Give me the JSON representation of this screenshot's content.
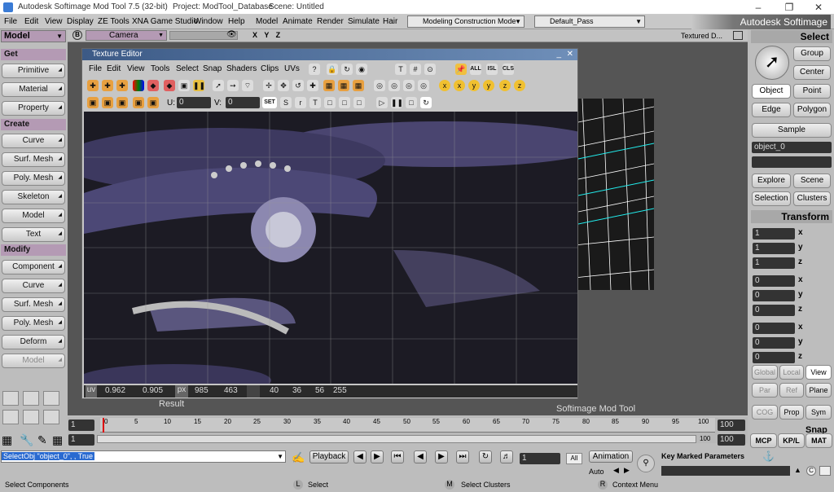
{
  "titlebar": {
    "app": "Autodesk Softimage Mod Tool 7.5 (32-bit)",
    "project": "Project: ModTool_Database",
    "scene": "Scene: Untitled"
  },
  "menu": [
    "File",
    "Edit",
    "View",
    "Display",
    "ZE Tools",
    "XNA Game Studio",
    "Window",
    "Help",
    "Model",
    "Animate",
    "Render",
    "Simulate",
    "Hair"
  ],
  "mode_combo": "Modeling Construction Mode",
  "pass_combo": "Default_Pass",
  "brand": "Autodesk Softimage",
  "left": {
    "module": "Model",
    "sections": [
      {
        "header": "Get",
        "items": [
          "Primitive",
          "Material",
          "Property"
        ]
      },
      {
        "header": "Create",
        "items": [
          "Curve",
          "Surf. Mesh",
          "Poly. Mesh",
          "Skeleton",
          "Model",
          "Text"
        ]
      },
      {
        "header": "Modify",
        "items": [
          "Component",
          "Curve",
          "Surf. Mesh",
          "Poly. Mesh",
          "Deform",
          "Model"
        ]
      }
    ]
  },
  "viewport": {
    "camera": "Camera",
    "axes": "X Y Z",
    "label": "Textured D...",
    "result": "Result",
    "watermark": "Softimage Mod Tool"
  },
  "texture_editor": {
    "title": "Texture Editor",
    "menu": [
      "File",
      "Edit",
      "View",
      "Tools",
      "Select",
      "Snap",
      "Shaders",
      "Clips",
      "UVs"
    ],
    "u_label": "U:",
    "u_value": "0",
    "v_label": "V:",
    "v_value": "0",
    "set": "SET",
    "tool_labels": [
      "ALL",
      "ISL",
      "CLS"
    ],
    "status": {
      "uv_label": "uv",
      "uv_u": "0.962",
      "uv_v": "0.905",
      "px_label": "px",
      "px_x": "985",
      "px_y": "463",
      "rgba": [
        "40",
        "36",
        "56",
        "255"
      ]
    }
  },
  "right": {
    "select_header": "Select",
    "group": "Group",
    "center": "Center",
    "object": "Object",
    "point": "Point",
    "edge": "Edge",
    "polygon": "Polygon",
    "sample": "Sample",
    "selection_name": "object_0",
    "explore": "Explore",
    "scene": "Scene",
    "selection": "Selection",
    "clusters": "Clusters",
    "transform_header": "Transform",
    "scale": [
      "1",
      "1",
      "1"
    ],
    "rotate": [
      "0",
      "0",
      "0"
    ],
    "translate": [
      "0",
      "0",
      "0"
    ],
    "axes": [
      "x",
      "y",
      "z"
    ],
    "global": "Global",
    "local": "Local",
    "view": "View",
    "par": "Par",
    "ref": "Ref",
    "plane": "Plane",
    "cog": "COG",
    "prop": "Prop",
    "sym": "Sym",
    "snap": "Snap",
    "mcp": "MCP",
    "kpl": "KP/L",
    "mat": "MAT"
  },
  "timeline": {
    "start": "1",
    "end": "100",
    "end2": "100",
    "current": "1",
    "range_end": "100",
    "ticks": [
      "0",
      "5",
      "10",
      "15",
      "20",
      "25",
      "30",
      "35",
      "40",
      "45",
      "50",
      "55",
      "60",
      "65",
      "70",
      "75",
      "80",
      "85",
      "90",
      "95",
      "100"
    ]
  },
  "bottom": {
    "command": "SelectObj \"object_0\", , True",
    "playback": "Playback",
    "frame": "1",
    "all": "All",
    "animation": "Animation",
    "auto": "Auto",
    "key_marked": "Key Marked Parameters",
    "status_left": "Select Components",
    "l_label": "L",
    "l_action": "Select",
    "m_label": "M",
    "m_action": "Select Clusters",
    "r_label": "R",
    "r_action": "Context Menu"
  }
}
